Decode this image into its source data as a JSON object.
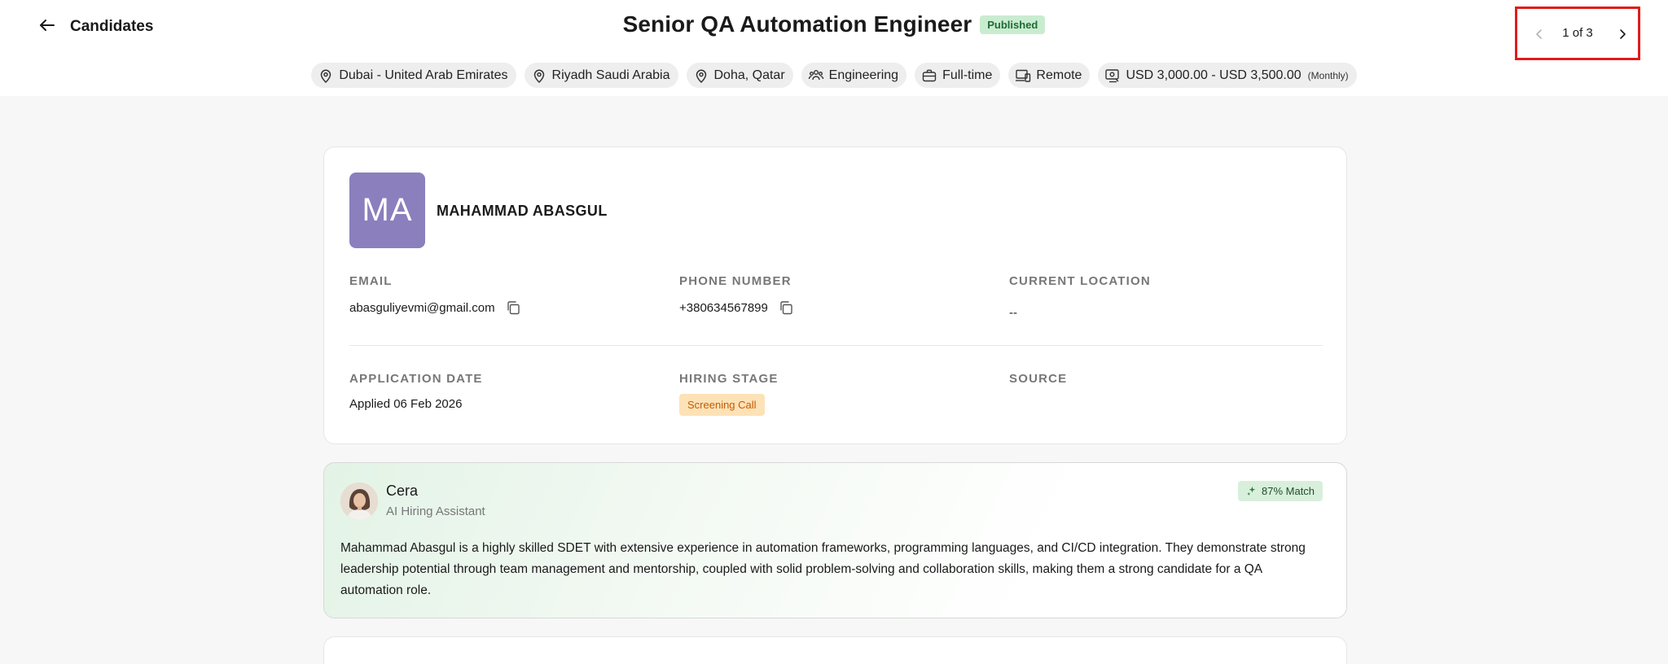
{
  "header": {
    "back_label": "Candidates",
    "job_title": "Senior QA Automation Engineer",
    "status_badge": "Published",
    "pager": {
      "text": "1 of 3"
    }
  },
  "tags": [
    {
      "icon": "location-pin-icon",
      "label": "Dubai - United Arab Emirates"
    },
    {
      "icon": "location-pin-icon",
      "label": "Riyadh Saudi Arabia"
    },
    {
      "icon": "location-pin-icon",
      "label": "Doha, Qatar"
    },
    {
      "icon": "team-icon",
      "label": "Engineering"
    },
    {
      "icon": "briefcase-icon",
      "label": "Full-time"
    },
    {
      "icon": "devices-icon",
      "label": "Remote"
    },
    {
      "icon": "salary-icon",
      "label": "USD 3,000.00 - USD 3,500.00",
      "suffix": "(Monthly)"
    }
  ],
  "candidate": {
    "initials": "MA",
    "name": "MAHAMMAD ABASGUL",
    "email_label": "EMAIL",
    "email": "abasguliyevmi@gmail.com",
    "phone_label": "PHONE NUMBER",
    "phone": "+380634567899",
    "location_label": "CURRENT LOCATION",
    "location": "--",
    "application_date_label": "APPLICATION DATE",
    "application_date": "Applied 06 Feb 2026",
    "hiring_stage_label": "HIRING STAGE",
    "hiring_stage": "Screening Call",
    "source_label": "SOURCE"
  },
  "assistant": {
    "name": "Cera",
    "role": "AI Hiring Assistant",
    "match": "87% Match",
    "summary": "Mahammad Abasgul is a highly skilled SDET with extensive experience in automation frameworks, programming languages, and CI/CD integration. They demonstrate strong leadership potential through team management and mentorship, coupled with solid problem-solving and collaboration skills, making them a strong candidate for a QA automation role."
  },
  "colors": {
    "avatar_bg": "#8b7fbd",
    "published_bg": "#c9ecd0",
    "stage_bg": "#fde2b7",
    "stage_text": "#c45b00",
    "highlight_border": "#e01c1c"
  }
}
